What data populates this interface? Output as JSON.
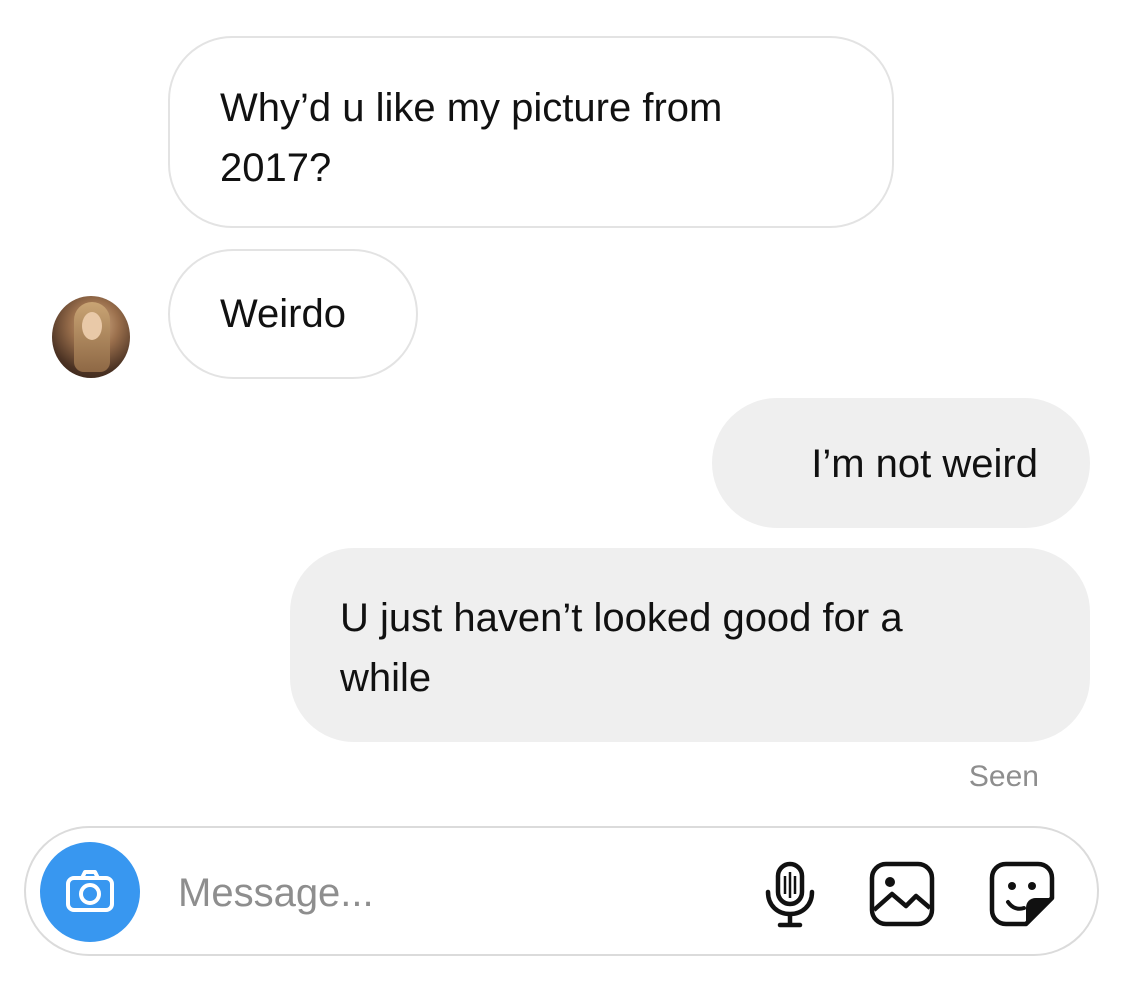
{
  "messages": [
    {
      "direction": "incoming",
      "text": "Why’d u like my picture from\n2017?"
    },
    {
      "direction": "incoming",
      "text": "Weirdo"
    },
    {
      "direction": "outgoing",
      "text": "I’m not weird"
    },
    {
      "direction": "outgoing",
      "text": "U just haven’t looked good for a\nwhile"
    }
  ],
  "status": {
    "seen": "Seen"
  },
  "composer": {
    "placeholder": "Message...",
    "icons": [
      "camera-icon",
      "microphone-icon",
      "gallery-icon",
      "sticker-icon"
    ],
    "camera_color": "#3897f0"
  },
  "colors": {
    "incoming_bubble": "#ffffff",
    "incoming_border": "#e3e3e3",
    "outgoing_bubble": "#efefef",
    "muted_text": "#8e8e8e"
  }
}
